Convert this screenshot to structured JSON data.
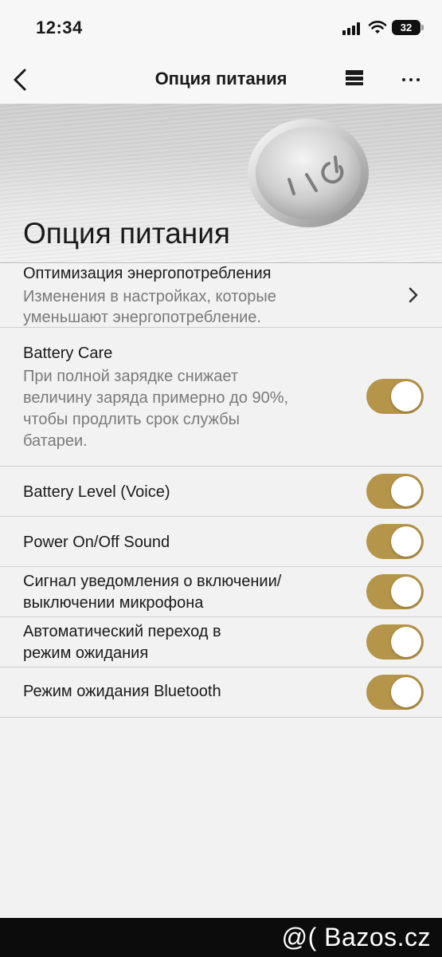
{
  "status_bar": {
    "time": "12:34",
    "battery": "32"
  },
  "nav": {
    "title": "Опция питания"
  },
  "hero": {
    "title": "Опция питания",
    "button_label": "I / ⏻"
  },
  "rows": [
    {
      "title": "Оптимизация энергопотребления",
      "subtitle": [
        "Изменения в настройках, которые",
        "уменьшают энергопотребление."
      ],
      "control": "chevron"
    },
    {
      "title": "Battery Care",
      "subtitle": [
        "При полной зарядке снижает",
        "величину заряда примерно до 90%,",
        "чтобы продлить срок службы",
        "батареи."
      ],
      "control": "toggle",
      "on": true
    },
    {
      "title": "Battery Level (Voice)",
      "control": "toggle",
      "on": true
    },
    {
      "title": "Power On/Off Sound",
      "control": "toggle",
      "on": true
    },
    {
      "title": [
        "Сигнал уведомления о включении/",
        "выключении микрофона"
      ],
      "control": "toggle",
      "on": true
    },
    {
      "title": [
        "Автоматический переход в",
        "режим ожидания"
      ],
      "control": "toggle",
      "on": true
    },
    {
      "title": "Режим ожидания Bluetooth",
      "control": "toggle",
      "on": true
    }
  ],
  "watermark": "@( Bazos.cz",
  "colors": {
    "toggle_on": "#b5954a",
    "background": "#f2f2f2"
  }
}
